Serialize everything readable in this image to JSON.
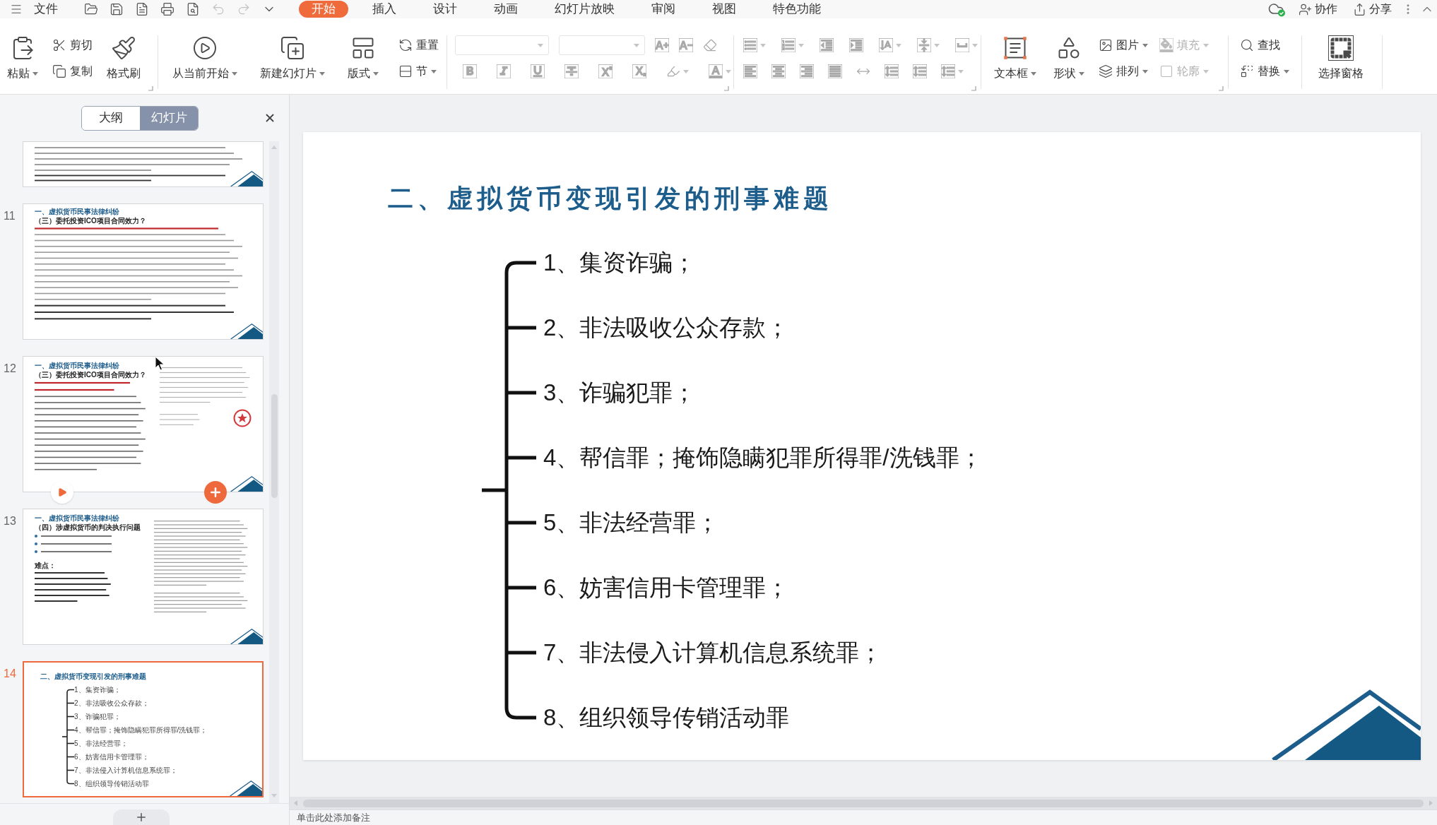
{
  "menu_bar": {
    "file_label": "文件",
    "quick_access": [
      {
        "disabled": false
      },
      {
        "disabled": false
      },
      {
        "disabled": false
      },
      {
        "disabled": false
      },
      {
        "disabled": false
      },
      {
        "disabled": true
      },
      {
        "disabled": true
      },
      {
        "disabled": false
      }
    ],
    "tabs": [
      {
        "label": "开始",
        "selected": true
      },
      {
        "label": "插入",
        "selected": false
      },
      {
        "label": "设计",
        "selected": false
      },
      {
        "label": "动画",
        "selected": false
      },
      {
        "label": "幻灯片放映",
        "selected": false
      },
      {
        "label": "审阅",
        "selected": false
      },
      {
        "label": "视图",
        "selected": false
      },
      {
        "label": "特色功能",
        "selected": false
      }
    ],
    "collaborate_label": "协作",
    "share_label": "分享"
  },
  "ribbon": {
    "groups": [
      {
        "kind": "columns",
        "dialog_launcher": true,
        "columns": [
          {
            "kind": "large",
            "label": "粘贴",
            "dropdown": true,
            "disabled": false
          },
          {
            "kind": "stack",
            "items": [
              {
                "label": "剪切",
                "dropdown": false,
                "disabled": false
              },
              {
                "label": "复制",
                "dropdown": false,
                "disabled": false
              }
            ]
          },
          {
            "kind": "large",
            "label": "格式刷",
            "dropdown": false,
            "disabled": false
          }
        ]
      },
      {
        "kind": "columns",
        "dialog_launcher": false,
        "columns": [
          {
            "kind": "large",
            "label": "从当前开始",
            "dropdown": true,
            "disabled": false
          },
          {
            "kind": "large",
            "label": "新建幻灯片",
            "dropdown": true,
            "disabled": false
          },
          {
            "kind": "large",
            "label": "版式",
            "dropdown": true,
            "disabled": false
          },
          {
            "kind": "stack",
            "items": [
              {
                "label": "重置",
                "dropdown": false,
                "disabled": false
              },
              {
                "label": "节",
                "dropdown": true,
                "disabled": false
              }
            ]
          }
        ]
      },
      {
        "kind": "rows",
        "dialog_launcher": true,
        "rows": [
          [
            {
              "kind": "field",
              "dropdown": true,
              "disabled": true
            },
            {
              "kind": "field",
              "dropdown": true,
              "disabled": true
            },
            {
              "kind": "icon",
              "dropdown": false,
              "disabled": true
            },
            {
              "kind": "icon",
              "dropdown": false,
              "disabled": true
            },
            {
              "kind": "icon",
              "dropdown": false,
              "disabled": true
            }
          ],
          [
            {
              "kind": "icon",
              "dropdown": false,
              "disabled": true
            },
            {
              "kind": "icon",
              "dropdown": false,
              "disabled": true
            },
            {
              "kind": "icon",
              "dropdown": false,
              "disabled": true
            },
            {
              "kind": "icon",
              "dropdown": false,
              "disabled": true
            },
            {
              "kind": "icon",
              "dropdown": false,
              "disabled": true
            },
            {
              "kind": "icon",
              "dropdown": false,
              "disabled": true
            },
            {
              "kind": "icon",
              "dropdown": true,
              "disabled": true
            },
            {
              "kind": "icon",
              "dropdown": true,
              "disabled": true
            }
          ]
        ]
      },
      {
        "kind": "rows",
        "dialog_launcher": true,
        "rows": [
          [
            {
              "kind": "icon",
              "dropdown": true,
              "disabled": true
            },
            {
              "kind": "icon",
              "dropdown": true,
              "disabled": true
            },
            {
              "kind": "icon",
              "dropdown": false,
              "disabled": true
            },
            {
              "kind": "icon",
              "dropdown": false,
              "disabled": true
            },
            {
              "kind": "icon",
              "dropdown": true,
              "disabled": true
            },
            {
              "kind": "icon",
              "dropdown": true,
              "disabled": true
            },
            {
              "kind": "icon",
              "dropdown": true,
              "disabled": true
            }
          ],
          [
            {
              "kind": "icon",
              "dropdown": false,
              "disabled": true
            },
            {
              "kind": "icon",
              "dropdown": false,
              "disabled": true
            },
            {
              "kind": "icon",
              "dropdown": false,
              "disabled": true
            },
            {
              "kind": "icon",
              "dropdown": false,
              "disabled": true
            },
            {
              "kind": "icon",
              "dropdown": false,
              "disabled": true
            },
            {
              "kind": "icon",
              "dropdown": false,
              "disabled": true
            },
            {
              "kind": "icon",
              "dropdown": false,
              "disabled": true
            },
            {
              "kind": "icon",
              "dropdown": true,
              "disabled": true
            }
          ]
        ]
      },
      {
        "kind": "columns",
        "dialog_launcher": true,
        "columns": [
          {
            "kind": "large",
            "label": "文本框",
            "dropdown": true,
            "disabled": false
          },
          {
            "kind": "large",
            "label": "形状",
            "dropdown": true,
            "disabled": false
          },
          {
            "kind": "stack",
            "items": [
              {
                "label": "图片",
                "dropdown": true,
                "disabled": false
              },
              {
                "label": "排列",
                "dropdown": true,
                "disabled": false
              }
            ]
          },
          {
            "kind": "stack",
            "items": [
              {
                "label": "填充",
                "dropdown": true,
                "disabled": true
              },
              {
                "label": "轮廓",
                "dropdown": true,
                "disabled": true
              }
            ]
          }
        ]
      },
      {
        "kind": "columns",
        "dialog_launcher": false,
        "columns": [
          {
            "kind": "stack",
            "items": [
              {
                "label": "查找",
                "dropdown": false,
                "disabled": false
              },
              {
                "label": "替换",
                "dropdown": true,
                "disabled": false
              }
            ]
          }
        ]
      },
      {
        "kind": "columns",
        "dialog_launcher": false,
        "columns": [
          {
            "kind": "large",
            "label": "选择窗格",
            "dropdown": false,
            "disabled": false
          }
        ]
      }
    ]
  },
  "slide_panel": {
    "view_tabs": [
      {
        "label": "大纲",
        "selected": false
      },
      {
        "label": "幻灯片",
        "selected": true
      }
    ],
    "slides": [
      {
        "kind": "clipped",
        "selected": false,
        "hovered": false
      },
      {
        "number": "11",
        "kind": "text",
        "selected": false,
        "hovered": false,
        "title": "一、虚拟货币民事法律纠纷",
        "subtitle": "（三）委托投资ICO项目合同效力？"
      },
      {
        "number": "12",
        "kind": "ruling",
        "selected": false,
        "hovered": true,
        "title": "一、虚拟货币民事法律纠纷",
        "subtitle": "（三）委托投资ICO项目合同效力？"
      },
      {
        "number": "13",
        "kind": "columns",
        "selected": false,
        "hovered": false,
        "title": "一、虚拟货币民事法律纠纷",
        "subtitle": "（四）涉虚拟货币的判决执行问题",
        "note": "难点："
      },
      {
        "number": "14",
        "kind": "outline",
        "selected": true,
        "hovered": false,
        "title": "二、虚拟货币变现引发的刑事难题",
        "items": [
          "1、集资诈骗；",
          "2、非法吸收公众存款；",
          "3、诈骗犯罪；",
          "4、帮信罪；掩饰隐瞒犯罪所得罪/洗钱罪；",
          "5、非法经营罪；",
          "6、妨害信用卡管理罪；",
          "7、非法侵入计算机信息系统罪；",
          "8、组织领导传销活动罪"
        ]
      }
    ]
  },
  "slide": {
    "title": "二、虚拟货币变现引发的刑事难题",
    "items": [
      "1、集资诈骗；",
      "2、非法吸收公众存款；",
      "3、诈骗犯罪；",
      "4、帮信罪；掩饰隐瞒犯罪所得罪/洗钱罪；",
      "5、非法经营罪；",
      "6、妨害信用卡管理罪；",
      "7、非法侵入计算机信息系统罪；",
      "8、组织领导传销活动罪"
    ]
  },
  "notes": {
    "placeholder": "单击此处添加备注"
  }
}
